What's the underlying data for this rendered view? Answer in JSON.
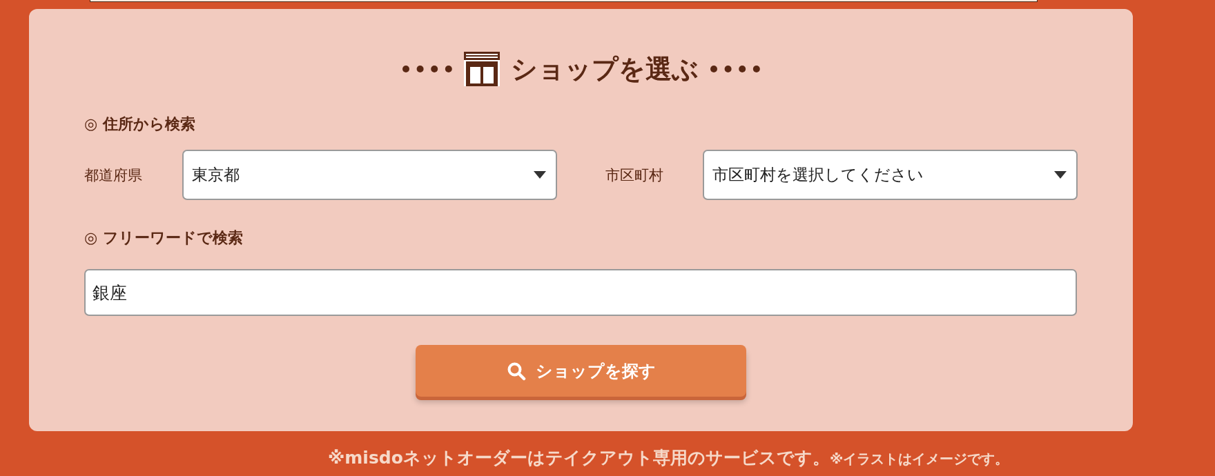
{
  "title": "ショップを選ぶ",
  "address_search": {
    "heading": "◎ 住所から検索",
    "fields": [
      {
        "label": "都道府県",
        "value": "東京都"
      },
      {
        "label": "市区町村",
        "value": "市区町村を選択してください"
      }
    ]
  },
  "freeword_search": {
    "heading": "◎ フリーワードで検索",
    "value": "銀座"
  },
  "search_button": "ショップを探す",
  "notes": [
    "※misdoネットオーダーはテイクアウト専用のサービスです。",
    "※イラストはイメージです。"
  ]
}
